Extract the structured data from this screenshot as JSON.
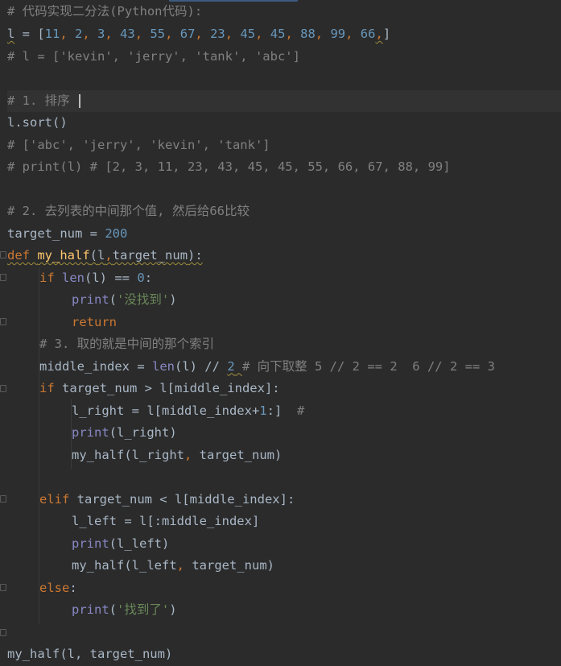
{
  "code": {
    "l1_comment": "# 代码实现二分法(Python代码):",
    "l2_var": "l",
    "l2_eq": " = [",
    "l2_nums": [
      "11",
      "2",
      "3",
      "43",
      "55",
      "67",
      "23",
      "45",
      "45",
      "88",
      "99",
      "66"
    ],
    "l2_sep": ", ",
    "l2_trailing_comma": ",",
    "l2_close": "]",
    "l3_comment": "# l = ['kevin', 'jerry', 'tank', 'abc']",
    "l5_comment": "# 1. 排序 ",
    "l6_code": "l.sort()",
    "l7_comment": "# ['abc', 'jerry', 'kevin', 'tank']",
    "l8_comment": "# print(l) # [2, 3, 11, 23, 43, 45, 45, 55, 66, 67, 88, 99]",
    "l10_comment": "# 2. 去列表的中间那个值, 然后给66比较",
    "l11_var": "target_num",
    "l11_eq": " = ",
    "l11_num": "200",
    "l12_def": "def",
    "l12_fname": "my_half",
    "l12_paren_open": "(",
    "l12_param1": "l",
    "l12_comma": ",",
    "l12_param2": "target_num",
    "l12_close": "):",
    "l13_if": "if",
    "l13_len": "len",
    "l13_mid": "(l) == ",
    "l13_zero": "0",
    "l13_colon": ":",
    "l14_print": "print",
    "l14_open": "(",
    "l14_str": "'没找到'",
    "l14_close": ")",
    "l15_return": "return",
    "l16_comment": "# 3. 取的就是中间的那个索引",
    "l17_var": "middle_index = ",
    "l17_len": "len",
    "l17_mid": "(l) // ",
    "l17_two": "2",
    "l17_comment": "# 向下取整 5 // 2 == 2  6 // 2 == 3",
    "l18_if": "if",
    "l18_cond": " target_num > l[middle_index]:",
    "l19_code_a": "l_right = l[middle_index+",
    "l19_one": "1",
    "l19_code_b": ":]  ",
    "l19_comment": "#",
    "l20_print": "print",
    "l20_args": "(l_right)",
    "l21_call": "my_half(l_right",
    "l21_comma": ",",
    "l21_rest": " target_num)",
    "l23_elif": "elif",
    "l23_cond": " target_num < l[middle_index]:",
    "l24_code": "l_left = l[:middle_index]",
    "l25_print": "print",
    "l25_args": "(l_left)",
    "l26_call": "my_half(l_left",
    "l26_comma": ",",
    "l26_rest": " target_num)",
    "l27_else": "else",
    "l27_colon": ":",
    "l28_print": "print",
    "l28_open": "(",
    "l28_str": "'找到了'",
    "l28_close": ")",
    "l30_partial": "my_half(l, target_num)"
  }
}
